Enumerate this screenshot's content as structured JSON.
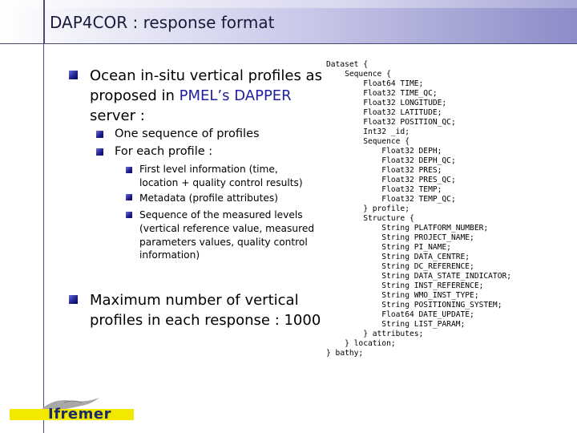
{
  "slide": {
    "title": "DAP4COR : response format"
  },
  "bullets": {
    "b1": {
      "line1": "Ocean in-situ vertical profiles as",
      "line2_pre": "proposed in ",
      "line2_hl": "PMEL’s DAPPER",
      "line3": "server :"
    },
    "b1_1": "One sequence of profiles",
    "b1_2": "For each profile :",
    "b1_2_1": {
      "line1": "First level information (time,",
      "line2": "location + quality control results)"
    },
    "b1_2_2": "Metadata (profile attributes)",
    "b1_2_3": {
      "line1": "Sequence of the measured levels",
      "line2": "(vertical reference value, measured",
      "line3": "parameters values, quality control",
      "line4": "information)"
    },
    "b2": {
      "line1": "Maximum number of vertical",
      "line2": "profiles in each response : 1000"
    }
  },
  "code": {
    "text": "Dataset {\n    Sequence {\n        Float64 TIME;\n        Float32 TIME_QC;\n        Float32 LONGITUDE;\n        Float32 LATITUDE;\n        Float32 POSITION_QC;\n        Int32 _id;\n        Sequence {\n            Float32 DEPH;\n            Float32 DEPH_QC;\n            Float32 PRES;\n            Float32 PRES_QC;\n            Float32 TEMP;\n            Float32 TEMP_QC;\n        } profile;\n        Structure {\n            String PLATFORM_NUMBER;\n            String PROJECT_NAME;\n            String PI_NAME;\n            String DATA_CENTRE;\n            String DC_REFERENCE;\n            String DATA_STATE_INDICATOR;\n            String INST_REFERENCE;\n            String WMO_INST_TYPE;\n            String POSITIONING_SYSTEM;\n            Float64 DATE_UPDATE;\n            String LIST_PARAM;\n        } attributes;\n    } location;\n} bathy;"
  },
  "logo": {
    "text": "Ifremer"
  },
  "colors": {
    "header_gradient_end": "#8c8cc8",
    "bullet": "#1c1c8c",
    "highlight": "#2020a0",
    "logo_bar": "#f2e800",
    "logo_text": "#1a2a6a"
  }
}
